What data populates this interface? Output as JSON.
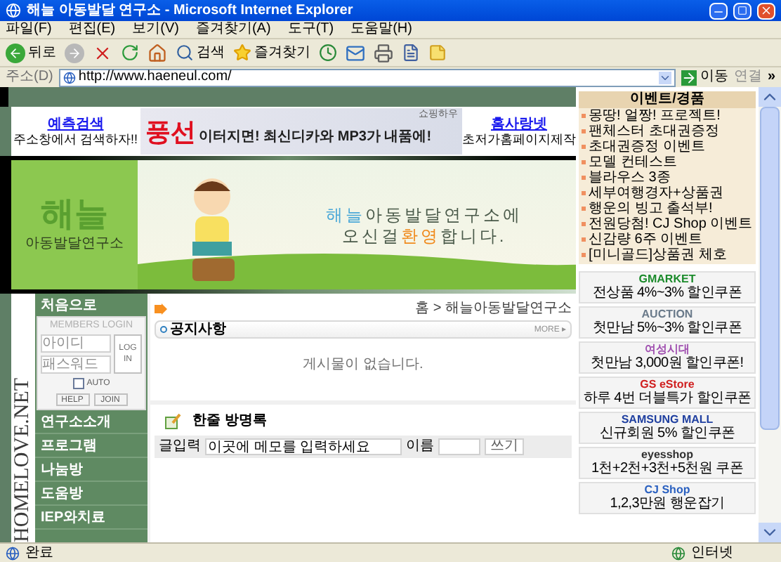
{
  "window": {
    "title": "해늘 아동발달 연구소 - Microsoft Internet Explorer"
  },
  "menu": [
    "파일(F)",
    "편집(E)",
    "보기(V)",
    "즐겨찾기(A)",
    "도구(T)",
    "도움말(H)"
  ],
  "toolbar": {
    "back": "뒤로",
    "search": "검색",
    "favorites": "즐겨찾기"
  },
  "address_bar": {
    "label": "주소(D)",
    "value": "http://www.haeneul.com/",
    "go": "이동",
    "links": "연결",
    "more": "»"
  },
  "top_links": [
    {
      "title": "예측검색",
      "text": "주소창에서 검색하자!!"
    },
    {
      "title": "홈사랑넷",
      "text": "초저가홈페이지제작"
    }
  ],
  "ad_banner": {
    "big": "풍선",
    "text": "이터지면! 최신디카와 MP3가 내품에!",
    "brand": "쇼핑하우"
  },
  "logo": {
    "name": "해늘",
    "subtitle": "아동발달연구소"
  },
  "welcome": [
    [
      {
        "text": "해늘",
        "color": "#4aa8d8"
      },
      {
        "text": "아동발달연구소에",
        "color": "#4a5a4a"
      }
    ],
    [
      {
        "text": "오신걸",
        "color": "#4a5a4a"
      },
      {
        "text": "환영",
        "color": "#f08a1c"
      },
      {
        "text": "합니다.",
        "color": "#4a5a4a"
      }
    ]
  ],
  "side_title": "HOMELOVE.NET",
  "sidebar": {
    "home": "처음으로",
    "login": {
      "title": "MEMBERS LOGIN",
      "id_placeholder": "아이디",
      "pw_placeholder": "패스워드",
      "button": "LOG IN",
      "auto": {
        "label": "AUTO",
        "checked": false
      },
      "help": "HELP",
      "join": "JOIN"
    },
    "items": [
      "연구소소개",
      "프로그램",
      "나눔방",
      "도움방",
      "IEP와치료"
    ]
  },
  "breadcrumb": "홈 > 해늘아동발달연구소",
  "notice": {
    "title": "공지사항",
    "more": "MORE ▸",
    "empty": "게시물이 없습니다."
  },
  "guestbook": {
    "title": "한줄 방명록",
    "label": "글입력",
    "value": "이곳에 메모를 입력하세요",
    "name_label": "이름",
    "submit": "쓰기"
  },
  "events": {
    "title": "이벤트/경품",
    "items": [
      "몽땅! 얼짱! 프로젝트!",
      "팬체스터 초대권증정",
      "초대권증정 이벤트",
      "모델 컨테스트",
      "블라우스 3종",
      "세부여행경자+상품권",
      "행운의 빙고 출석부!",
      "전원당첨! CJ Shop 이벤트",
      "신감량 6주 이벤트",
      "[미니골드]상품권 체호"
    ]
  },
  "coupons": [
    {
      "brand": "GMARKET",
      "color": "#1a8a2a",
      "text": "전상품 4%~3% 할인쿠폰"
    },
    {
      "brand": "AUCTION",
      "color": "#6a7a8a",
      "text": "첫만남 5%~3% 할인쿠폰"
    },
    {
      "brand": "여성시대",
      "color": "#a050b0",
      "text": "첫만남 3,000원 할인쿠폰!"
    },
    {
      "brand": "GS eStore",
      "color": "#d02020",
      "text": "하루 4번 더블특가 할인쿠폰"
    },
    {
      "brand": "SAMSUNG MALL",
      "color": "#2040a0",
      "text": "신규회원 5% 할인쿠폰"
    },
    {
      "brand": "eyesshop",
      "color": "#303030",
      "text": "1천+2천+3천+5천원 쿠폰"
    },
    {
      "brand": "CJ Shop",
      "color": "#2a60c0",
      "text": "1,2,3만원 행운잡기"
    }
  ],
  "status_bar": {
    "text": "완료",
    "zone": "인터넷"
  }
}
